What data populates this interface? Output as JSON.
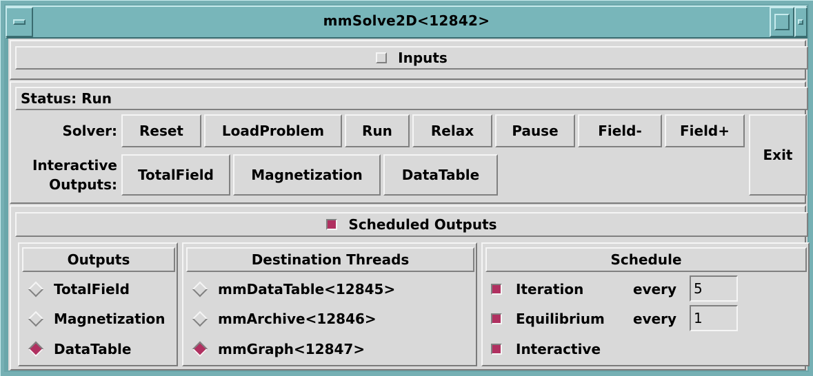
{
  "window": {
    "title": "mmSolve2D<12842>"
  },
  "inputs": {
    "label": "Inputs",
    "checked": false
  },
  "status": {
    "text": "Status: Run"
  },
  "solver": {
    "label": "Solver:",
    "buttons": [
      "Reset",
      "LoadProblem",
      "Run",
      "Relax",
      "Pause",
      "Field-",
      "Field+"
    ],
    "exit_label": "Exit"
  },
  "interactive": {
    "label_line1": "Interactive",
    "label_line2": "Outputs:",
    "buttons": [
      "TotalField",
      "Magnetization",
      "DataTable"
    ]
  },
  "scheduled": {
    "label": "Scheduled Outputs",
    "checked": true
  },
  "outputs": {
    "header": "Outputs",
    "items": [
      {
        "label": "TotalField",
        "selected": false
      },
      {
        "label": "Magnetization",
        "selected": false
      },
      {
        "label": "DataTable",
        "selected": true
      }
    ]
  },
  "destinations": {
    "header": "Destination Threads",
    "items": [
      {
        "label": "mmDataTable<12845>",
        "selected": false
      },
      {
        "label": "mmArchive<12846>",
        "selected": false
      },
      {
        "label": "mmGraph<12847>",
        "selected": true
      }
    ]
  },
  "schedule": {
    "header": "Schedule",
    "every_label": "every",
    "items": [
      {
        "label": "Iteration",
        "checked": true,
        "every": "5"
      },
      {
        "label": "Equilibrium",
        "checked": true,
        "every": "1"
      },
      {
        "label": "Interactive",
        "checked": true
      }
    ]
  },
  "colors": {
    "frame": "#76b0b4",
    "background": "#d9d9d9",
    "indicator_on": "#b03060"
  }
}
